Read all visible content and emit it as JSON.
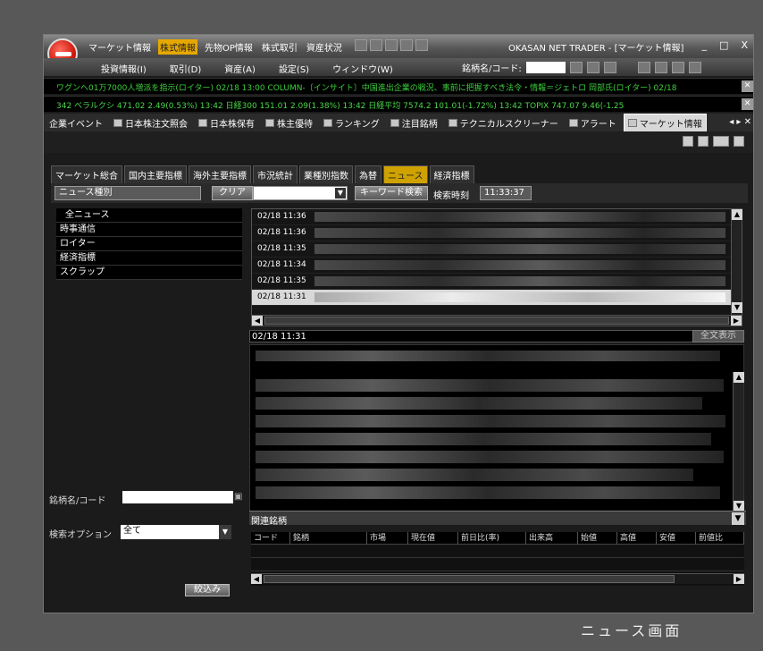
{
  "app": {
    "title": "OKASAN NET TRADER - [マーケット情報]",
    "menu_top": [
      "マーケット情報",
      "株式情報",
      "先物OP情報",
      "株式取引",
      "資産状況"
    ],
    "menu_top_highlight": "株式情報",
    "menu_main": [
      "投資情報(I)",
      "取引(D)",
      "資産(A)",
      "設定(S)",
      "ウィンドウ(W)"
    ],
    "code_label": "銘柄名/コード:",
    "window_controls": [
      "_",
      "□",
      "X"
    ]
  },
  "tickers": [
    "ワグンへ01万7000人増派を指示(ロイター) 02/18 13:00 COLUMN-〔インサイト〕中国進出企業の戦況、事前に把握すべき法令・情報＝ジェトロ 岡部氏(ロイター) 02/18",
    "342   ベラルクシ 471.02  2.49(0.53%) 13:42      日経300 151.01  2.09(1.38%) 13:42      日経平均 7574.2  101.01(-1.72%) 13:42      TOPIX 747.07  9.46(-1.25"
  ],
  "window_tabs": [
    "企業イベント",
    "日本株注文照会",
    "日本株保有",
    "株主優待",
    "ランキング",
    "注目銘柄",
    "テクニカルスクリーナー",
    "アラート",
    "マーケット情報"
  ],
  "active_window_tab": "マーケット情報",
  "sub_tabs": [
    "マーケット総合",
    "国内主要指標",
    "海外主要指標",
    "市況統計",
    "業種別指数",
    "為替",
    "ニュース",
    "経済指標"
  ],
  "active_sub_tab": "ニュース",
  "filter": {
    "category_label": "ニュース種別",
    "clear_label": "クリア",
    "keyword_button": "キーワード検索",
    "search_time_label": "検索時刻",
    "search_time_value": "11:33:37"
  },
  "categories": [
    "全ニュース",
    "時事通信",
    "ロイター",
    "経済指標",
    "スクラップ"
  ],
  "news_times": [
    "02/18 11:36",
    "02/18 11:36",
    "02/18 11:35",
    "02/18 11:34",
    "02/18 11:35",
    "02/18 11:31"
  ],
  "selected_news_index": 5,
  "detail": {
    "datetime": "02/18 11:31",
    "button": "全文表示"
  },
  "bottom_left": {
    "code_label": "銘柄名/コード",
    "option_label": "検索オプション",
    "option_value": "全て",
    "filter_button": "絞込み"
  },
  "related": {
    "title": "関連銘柄",
    "columns": [
      "コード",
      "銘柄",
      "市場",
      "現在値",
      "前日比(率)",
      "出来高",
      "始値",
      "高値",
      "安値",
      "前値比"
    ]
  },
  "caption": "ニュース画面"
}
